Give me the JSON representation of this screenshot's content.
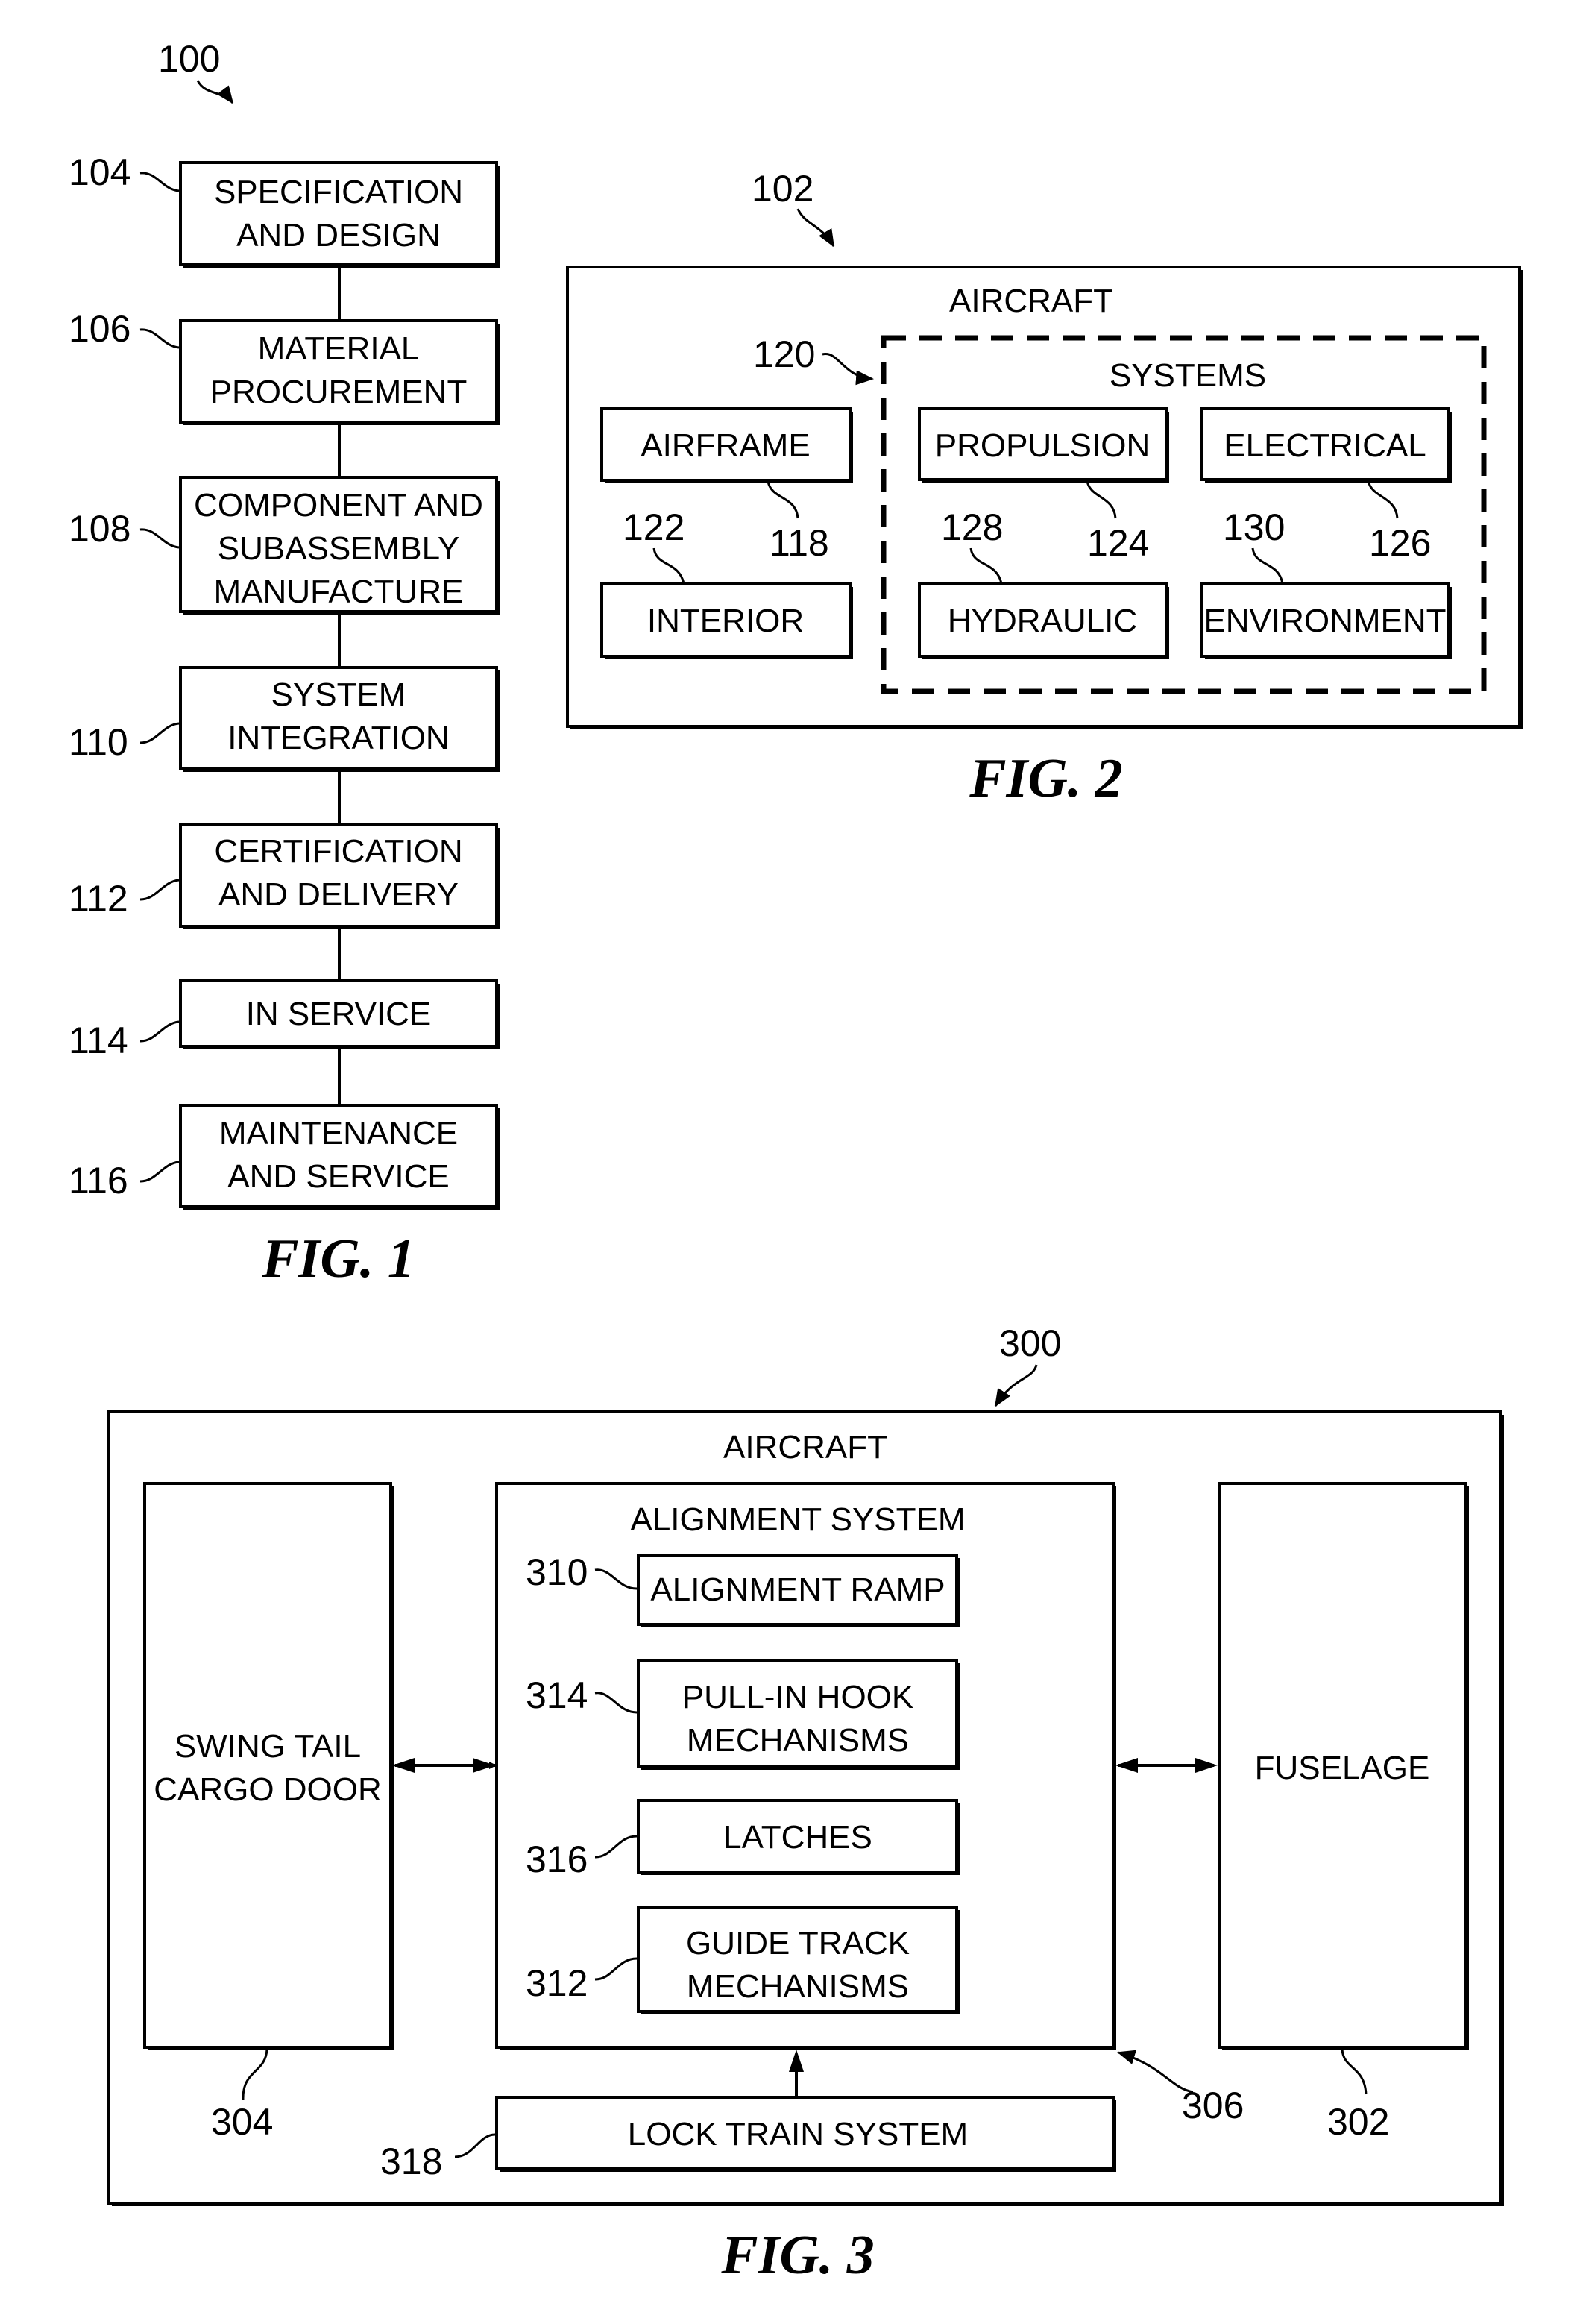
{
  "fig1": {
    "caption": "FIG. 1",
    "ref": "100",
    "steps": [
      {
        "ref": "104",
        "lines": [
          "SPECIFICATION",
          "AND DESIGN"
        ]
      },
      {
        "ref": "106",
        "lines": [
          "MATERIAL",
          "PROCUREMENT"
        ]
      },
      {
        "ref": "108",
        "lines": [
          "COMPONENT AND",
          "SUBASSEMBLY",
          "MANUFACTURE"
        ]
      },
      {
        "ref": "110",
        "lines": [
          "SYSTEM",
          "INTEGRATION"
        ]
      },
      {
        "ref": "112",
        "lines": [
          "CERTIFICATION",
          "AND DELIVERY"
        ]
      },
      {
        "ref": "114",
        "lines": [
          "IN SERVICE"
        ]
      },
      {
        "ref": "116",
        "lines": [
          "MAINTENANCE",
          "AND SERVICE"
        ]
      }
    ]
  },
  "fig2": {
    "caption": "FIG. 2",
    "ref": "102",
    "title": "AIRCRAFT",
    "airframe": {
      "label": "AIRFRAME",
      "ref": "118"
    },
    "interior": {
      "label": "INTERIOR",
      "ref": "122"
    },
    "systems": {
      "label": "SYSTEMS",
      "ref": "120",
      "propulsion": {
        "label": "PROPULSION",
        "ref": "124"
      },
      "electrical": {
        "label": "ELECTRICAL",
        "ref": "126"
      },
      "hydraulic": {
        "label": "HYDRAULIC",
        "ref": "128"
      },
      "environment": {
        "label": "ENVIRONMENT",
        "ref": "130"
      }
    }
  },
  "fig3": {
    "caption": "FIG. 3",
    "ref": "300",
    "title": "AIRCRAFT",
    "swing_tail": {
      "lines": [
        "SWING TAIL",
        "CARGO DOOR"
      ],
      "ref": "304"
    },
    "fuselage": {
      "label": "FUSELAGE",
      "ref": "302"
    },
    "alignment_system": {
      "label": "ALIGNMENT SYSTEM",
      "ref": "306",
      "components": [
        {
          "ref": "310",
          "lines": [
            "ALIGNMENT RAMP"
          ]
        },
        {
          "ref": "314",
          "lines": [
            "PULL-IN HOOK",
            "MECHANISMS"
          ]
        },
        {
          "ref": "316",
          "lines": [
            "LATCHES"
          ]
        },
        {
          "ref": "312",
          "lines": [
            "GUIDE TRACK",
            "MECHANISMS"
          ]
        }
      ]
    },
    "lock_train": {
      "label": "LOCK TRAIN SYSTEM",
      "ref": "318"
    }
  }
}
